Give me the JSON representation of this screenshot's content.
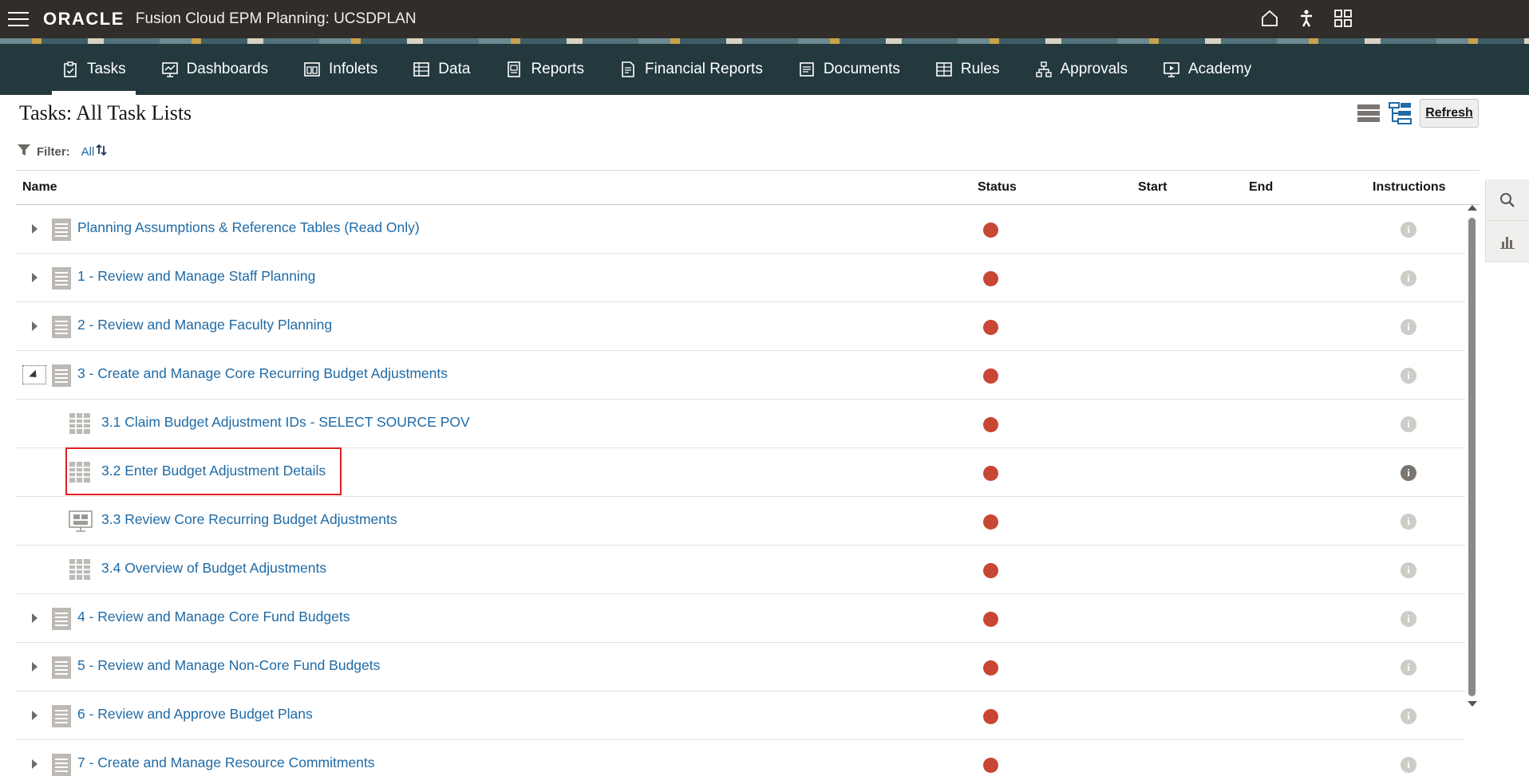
{
  "header": {
    "logo": "ORACLE",
    "app_title": "Fusion Cloud EPM Planning:  UCSDPLAN",
    "icons": [
      "home-icon",
      "accessibility-icon",
      "navigator-grid-icon"
    ]
  },
  "nav": {
    "items": [
      {
        "label": "Tasks",
        "icon": "clipboard-icon",
        "active": true
      },
      {
        "label": "Dashboards",
        "icon": "dashboard-icon"
      },
      {
        "label": "Infolets",
        "icon": "infolets-icon"
      },
      {
        "label": "Data",
        "icon": "data-grid-icon"
      },
      {
        "label": "Reports",
        "icon": "reports-icon"
      },
      {
        "label": "Financial Reports",
        "icon": "financial-reports-icon"
      },
      {
        "label": "Documents",
        "icon": "documents-icon"
      },
      {
        "label": "Rules",
        "icon": "rules-icon"
      },
      {
        "label": "Approvals",
        "icon": "approvals-icon"
      },
      {
        "label": "Academy",
        "icon": "academy-icon"
      }
    ]
  },
  "page": {
    "title": "Tasks: All Task Lists",
    "refresh_label": "Refresh",
    "filter_label": "Filter:",
    "filter_value": "All"
  },
  "table": {
    "columns": {
      "name": "Name",
      "status": "Status",
      "start": "Start",
      "end": "End",
      "instructions": "Instructions"
    },
    "rows": [
      {
        "label": "Planning Assumptions & Reference Tables (Read Only)",
        "type": "tasklist",
        "expanded": false,
        "level": 0,
        "status_color": "#c74634"
      },
      {
        "label": "1 - Review and Manage Staff Planning",
        "type": "tasklist",
        "expanded": false,
        "level": 0,
        "status_color": "#c74634"
      },
      {
        "label": "2 - Review and Manage Faculty Planning",
        "type": "tasklist",
        "expanded": false,
        "level": 0,
        "status_color": "#c74634"
      },
      {
        "label": "3 - Create and Manage Core Recurring Budget Adjustments",
        "type": "tasklist",
        "expanded": true,
        "level": 0,
        "status_color": "#c74634"
      },
      {
        "label": "3.1 Claim Budget Adjustment IDs - SELECT SOURCE POV",
        "type": "form",
        "level": 1,
        "status_color": "#c74634"
      },
      {
        "label": "3.2 Enter Budget Adjustment Details",
        "type": "form",
        "level": 1,
        "status_color": "#c74634",
        "highlighted": true
      },
      {
        "label": "3.3 Review Core Recurring Budget Adjustments",
        "type": "dashboard",
        "level": 1,
        "status_color": "#c74634"
      },
      {
        "label": "3.4 Overview of Budget Adjustments",
        "type": "form",
        "level": 1,
        "status_color": "#c74634"
      },
      {
        "label": "4 - Review and Manage Core Fund Budgets",
        "type": "tasklist",
        "expanded": false,
        "level": 0,
        "status_color": "#c74634"
      },
      {
        "label": "5 - Review and Manage Non-Core Fund Budgets",
        "type": "tasklist",
        "expanded": false,
        "level": 0,
        "status_color": "#c74634"
      },
      {
        "label": "6 - Review and Approve Budget Plans",
        "type": "tasklist",
        "expanded": false,
        "level": 0,
        "status_color": "#c74634"
      },
      {
        "label": "7 - Create and Manage Resource Commitments",
        "type": "tasklist",
        "expanded": false,
        "level": 0,
        "status_color": "#c74634"
      }
    ]
  },
  "side_panel": {
    "icons": [
      "search-icon",
      "chart-icon"
    ]
  }
}
